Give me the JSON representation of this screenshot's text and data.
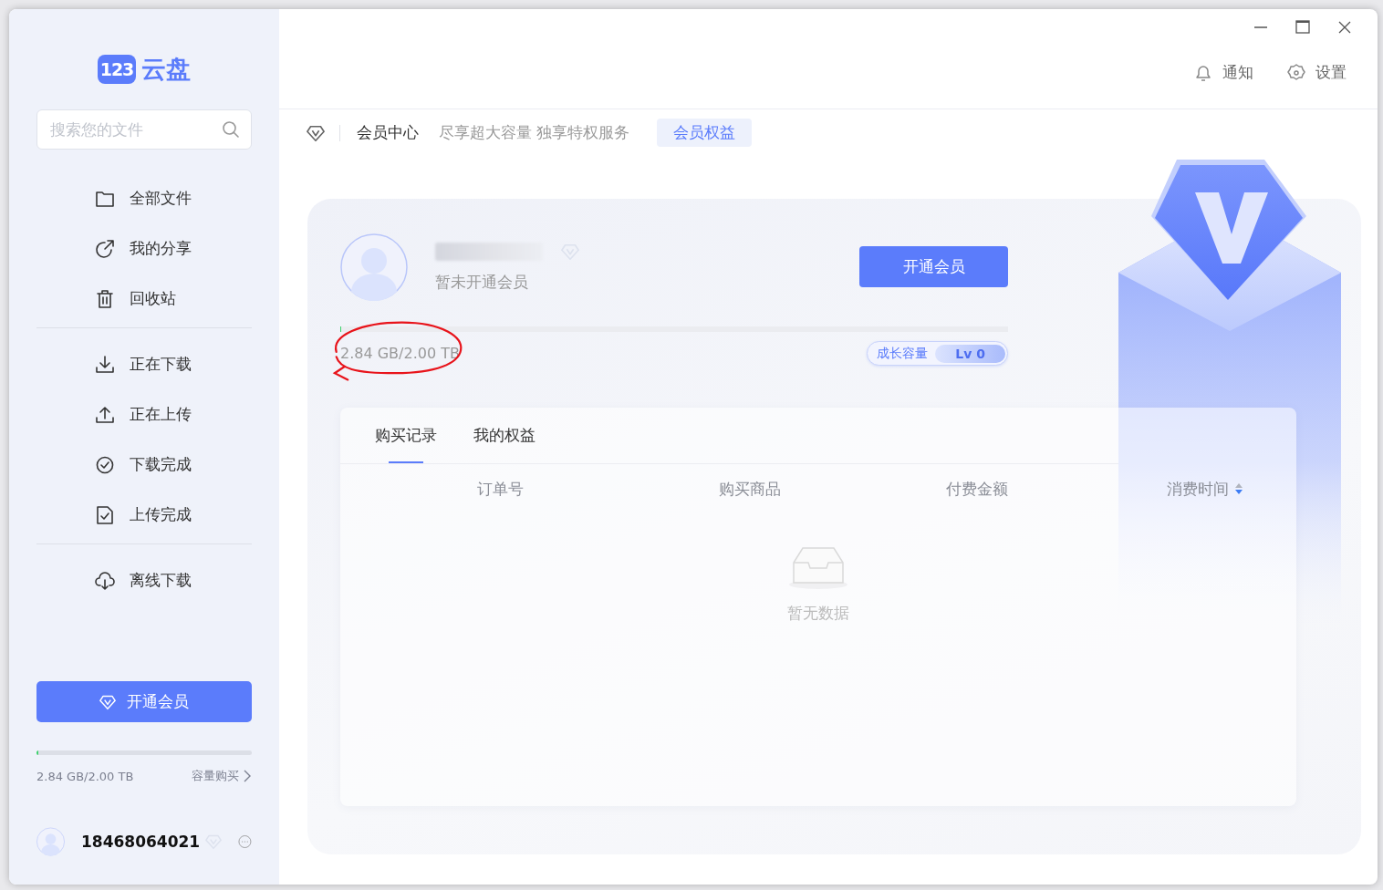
{
  "sidebar": {
    "logo": {
      "badge": "123",
      "name": "云盘"
    },
    "search": {
      "placeholder": "搜索您的文件"
    },
    "nav_groups": [
      [
        {
          "label": "全部文件",
          "kind": "folder"
        },
        {
          "label": "我的分享",
          "kind": "share"
        },
        {
          "label": "回收站",
          "kind": "trash"
        }
      ],
      [
        {
          "label": "正在下载",
          "kind": "download"
        },
        {
          "label": "正在上传",
          "kind": "upload"
        },
        {
          "label": "下载完成",
          "kind": "done"
        },
        {
          "label": "上传完成",
          "kind": "file-done"
        }
      ],
      [
        {
          "label": "离线下载",
          "kind": "cloud"
        }
      ]
    ],
    "vip_button": "开通会员",
    "storage": {
      "level": 0.0014,
      "usage": "2.84 GB/2.00 TB",
      "buy_link": "容量购买"
    },
    "user": {
      "phone": "18468064021"
    }
  },
  "header": {
    "actions": [
      {
        "label": "通知",
        "kind": "bell"
      },
      {
        "label": "设置",
        "kind": "gear"
      }
    ]
  },
  "breadcrumb": {
    "title": "会员中心",
    "slogan": "尽享超大容量 独享特权服务",
    "tag": "会员权益"
  },
  "profile": {
    "status": "暂未开通会员",
    "open_button": "开通会员",
    "storage": {
      "level": 0.0014,
      "usage": "2.84 GB/2.00 TB"
    },
    "growth": {
      "label": "成长容量",
      "level_text": "Lv 0"
    }
  },
  "records": {
    "tabs": [
      {
        "label": "购买记录",
        "selected": true
      },
      {
        "label": "我的权益",
        "selected": false
      }
    ],
    "columns": [
      {
        "label": "订单号",
        "sortable": false
      },
      {
        "label": "购买商品",
        "sortable": false
      },
      {
        "label": "付费金额",
        "sortable": false
      },
      {
        "label": "消费时间",
        "sortable": true
      }
    ],
    "empty": "暂无数据"
  }
}
